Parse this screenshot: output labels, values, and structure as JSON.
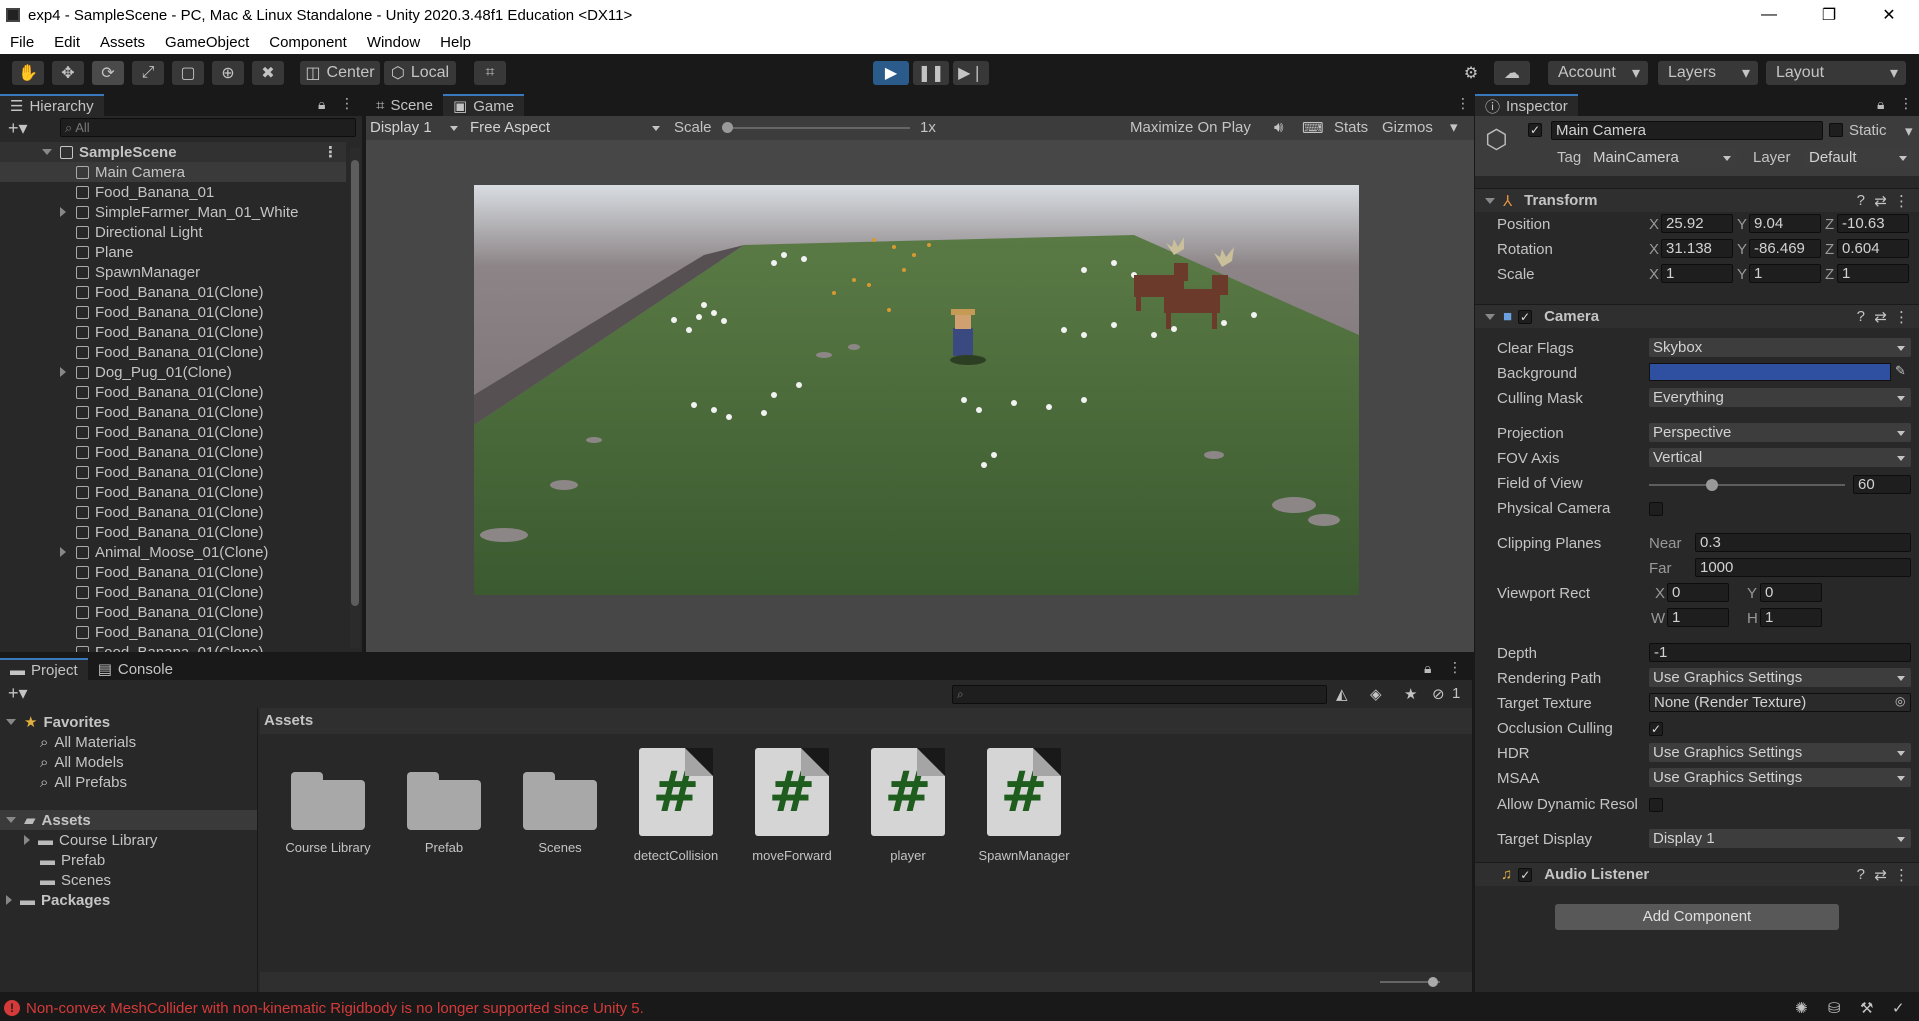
{
  "window": {
    "title": "exp4 - SampleScene - PC, Mac & Linux Standalone - Unity 2020.3.48f1 Education <DX11>",
    "minimize": "—",
    "restore": "❐",
    "close": "✕"
  },
  "menu": [
    "File",
    "Edit",
    "Assets",
    "GameObject",
    "Component",
    "Window",
    "Help"
  ],
  "toolbar": {
    "pivot": "Center",
    "space": "Local",
    "account": "Account",
    "layers": "Layers",
    "layout": "Layout",
    "play_state": "playing"
  },
  "hierarchy": {
    "tab": "Hierarchy",
    "search_placeholder": "All",
    "scene": "SampleScene",
    "items": [
      {
        "label": "Main Camera",
        "expandable": false,
        "selected": true
      },
      {
        "label": "Food_Banana_01",
        "expandable": false
      },
      {
        "label": "SimpleFarmer_Man_01_White",
        "expandable": true
      },
      {
        "label": "Directional Light",
        "expandable": false
      },
      {
        "label": "Plane",
        "expandable": false
      },
      {
        "label": "SpawnManager",
        "expandable": false
      },
      {
        "label": "Food_Banana_01(Clone)",
        "expandable": false
      },
      {
        "label": "Food_Banana_01(Clone)",
        "expandable": false
      },
      {
        "label": "Food_Banana_01(Clone)",
        "expandable": false
      },
      {
        "label": "Food_Banana_01(Clone)",
        "expandable": false
      },
      {
        "label": "Dog_Pug_01(Clone)",
        "expandable": true
      },
      {
        "label": "Food_Banana_01(Clone)",
        "expandable": false
      },
      {
        "label": "Food_Banana_01(Clone)",
        "expandable": false
      },
      {
        "label": "Food_Banana_01(Clone)",
        "expandable": false
      },
      {
        "label": "Food_Banana_01(Clone)",
        "expandable": false
      },
      {
        "label": "Food_Banana_01(Clone)",
        "expandable": false
      },
      {
        "label": "Food_Banana_01(Clone)",
        "expandable": false
      },
      {
        "label": "Food_Banana_01(Clone)",
        "expandable": false
      },
      {
        "label": "Food_Banana_01(Clone)",
        "expandable": false
      },
      {
        "label": "Animal_Moose_01(Clone)",
        "expandable": true
      },
      {
        "label": "Food_Banana_01(Clone)",
        "expandable": false
      },
      {
        "label": "Food_Banana_01(Clone)",
        "expandable": false
      },
      {
        "label": "Food_Banana_01(Clone)",
        "expandable": false
      },
      {
        "label": "Food_Banana_01(Clone)",
        "expandable": false
      },
      {
        "label": "Food_Banana_01(Clone)",
        "expandable": false
      }
    ]
  },
  "game": {
    "tab_scene": "Scene",
    "tab_game": "Game",
    "display": "Display 1",
    "aspect": "Free Aspect",
    "scale_label": "Scale",
    "scale_value": "1x",
    "maximize": "Maximize On Play",
    "stats": "Stats",
    "gizmos": "Gizmos"
  },
  "project": {
    "tab_project": "Project",
    "tab_console": "Console",
    "favorites": "Favorites",
    "fav_items": [
      "All Materials",
      "All Models",
      "All Prefabs"
    ],
    "assets_root": "Assets",
    "asset_tree": [
      "Course Library",
      "Prefab",
      "Scenes"
    ],
    "packages": "Packages",
    "breadcrumb": "Assets",
    "hidden_count": "1",
    "items": [
      {
        "label": "Course Library",
        "kind": "folder"
      },
      {
        "label": "Prefab",
        "kind": "folder"
      },
      {
        "label": "Scenes",
        "kind": "folder"
      },
      {
        "label": "detectCollision",
        "kind": "script"
      },
      {
        "label": "moveForward",
        "kind": "script"
      },
      {
        "label": "player",
        "kind": "script"
      },
      {
        "label": "SpawnManager",
        "kind": "script"
      }
    ],
    "script_glyph": "#"
  },
  "inspector": {
    "tab": "Inspector",
    "name": "Main Camera",
    "static": "Static",
    "tag_label": "Tag",
    "tag": "MainCamera",
    "layer_label": "Layer",
    "layer": "Default",
    "transform": {
      "title": "Transform",
      "rows": [
        {
          "label": "Position",
          "x": "25.92",
          "y": "9.04",
          "z": "-10.63"
        },
        {
          "label": "Rotation",
          "x": "31.138",
          "y": "-86.469",
          "z": "0.604"
        },
        {
          "label": "Scale",
          "x": "1",
          "y": "1",
          "z": "1"
        }
      ]
    },
    "axes": [
      "X",
      "Y",
      "Z",
      "W",
      "H"
    ],
    "camera": {
      "title": "Camera",
      "clear_flags_label": "Clear Flags",
      "clear_flags": "Skybox",
      "background_label": "Background",
      "background_color": "#2f4fa0",
      "culling_label": "Culling Mask",
      "culling": "Everything",
      "projection_label": "Projection",
      "projection": "Perspective",
      "fov_axis_label": "FOV Axis",
      "fov_axis": "Vertical",
      "fov_label": "Field of View",
      "fov": "60",
      "fov_fraction": 0.32,
      "physical_label": "Physical Camera",
      "clipping_label": "Clipping Planes",
      "near_label": "Near",
      "near": "0.3",
      "far_label": "Far",
      "far": "1000",
      "viewport_label": "Viewport Rect",
      "vx": "0",
      "vy": "0",
      "vw": "1",
      "vh": "1",
      "depth_label": "Depth",
      "depth": "-1",
      "rendering_label": "Rendering Path",
      "rendering": "Use Graphics Settings",
      "target_tex_label": "Target Texture",
      "target_tex": "None (Render Texture)",
      "occlusion_label": "Occlusion Culling",
      "hdr_label": "HDR",
      "hdr": "Use Graphics Settings",
      "msaa_label": "MSAA",
      "msaa": "Use Graphics Settings",
      "dynres_label": "Allow Dynamic Resol",
      "target_display_label": "Target Display",
      "target_display": "Display 1"
    },
    "audio": {
      "title": "Audio Listener"
    },
    "add_component": "Add Component"
  },
  "status": {
    "message": "Non-convex MeshCollider with non-kinematic Rigidbody is no longer supported since Unity 5.",
    "error_color": "#d53a3a"
  },
  "colors": {
    "accent": "#3a79bb",
    "panel": "#282828",
    "dark": "#191919",
    "script_green": "#1e5d1e"
  }
}
